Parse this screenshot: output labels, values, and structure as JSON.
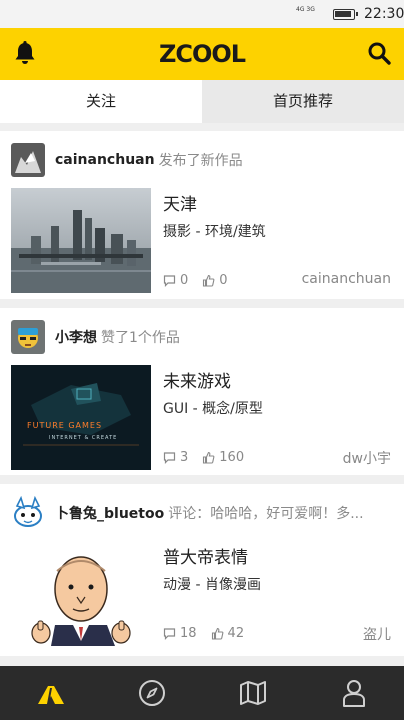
{
  "status_bar": {
    "network": "4G 3G",
    "time": "22:30"
  },
  "app_bar": {
    "logo": "ZCOOL",
    "left_icon": "bell-icon",
    "right_icon": "search-icon",
    "accent_color": "#fdd200"
  },
  "tabs": [
    {
      "label": "关注"
    },
    {
      "label": "首页推荐"
    }
  ],
  "feed": [
    {
      "user": "cainanchuan",
      "action": "发布了新作品",
      "title": "天津",
      "category": "摄影 - 环境/建筑",
      "comments": "0",
      "likes": "0",
      "author": "cainanchuan"
    },
    {
      "user": "小李想",
      "action": "赞了1个作品",
      "title": "未来游戏",
      "category": "GUI - 概念/原型",
      "comments": "3",
      "likes": "160",
      "author": "dw小宇",
      "thumb_text": "FUTURE GAMES",
      "thumb_subtext": "INTERNET & CREATE"
    },
    {
      "user": "卜鲁兔_bluetoo",
      "action": "评论：哈哈哈，好可爱啊！多...",
      "title": "普大帝表情",
      "category": "动漫 - 肖像漫画",
      "comments": "18",
      "likes": "42",
      "author": "盗儿"
    }
  ],
  "bottom_nav": [
    {
      "icon": "zcool-home-icon",
      "active": true
    },
    {
      "icon": "compass-icon",
      "active": false
    },
    {
      "icon": "map-icon",
      "active": false
    },
    {
      "icon": "user-icon",
      "active": false
    }
  ]
}
